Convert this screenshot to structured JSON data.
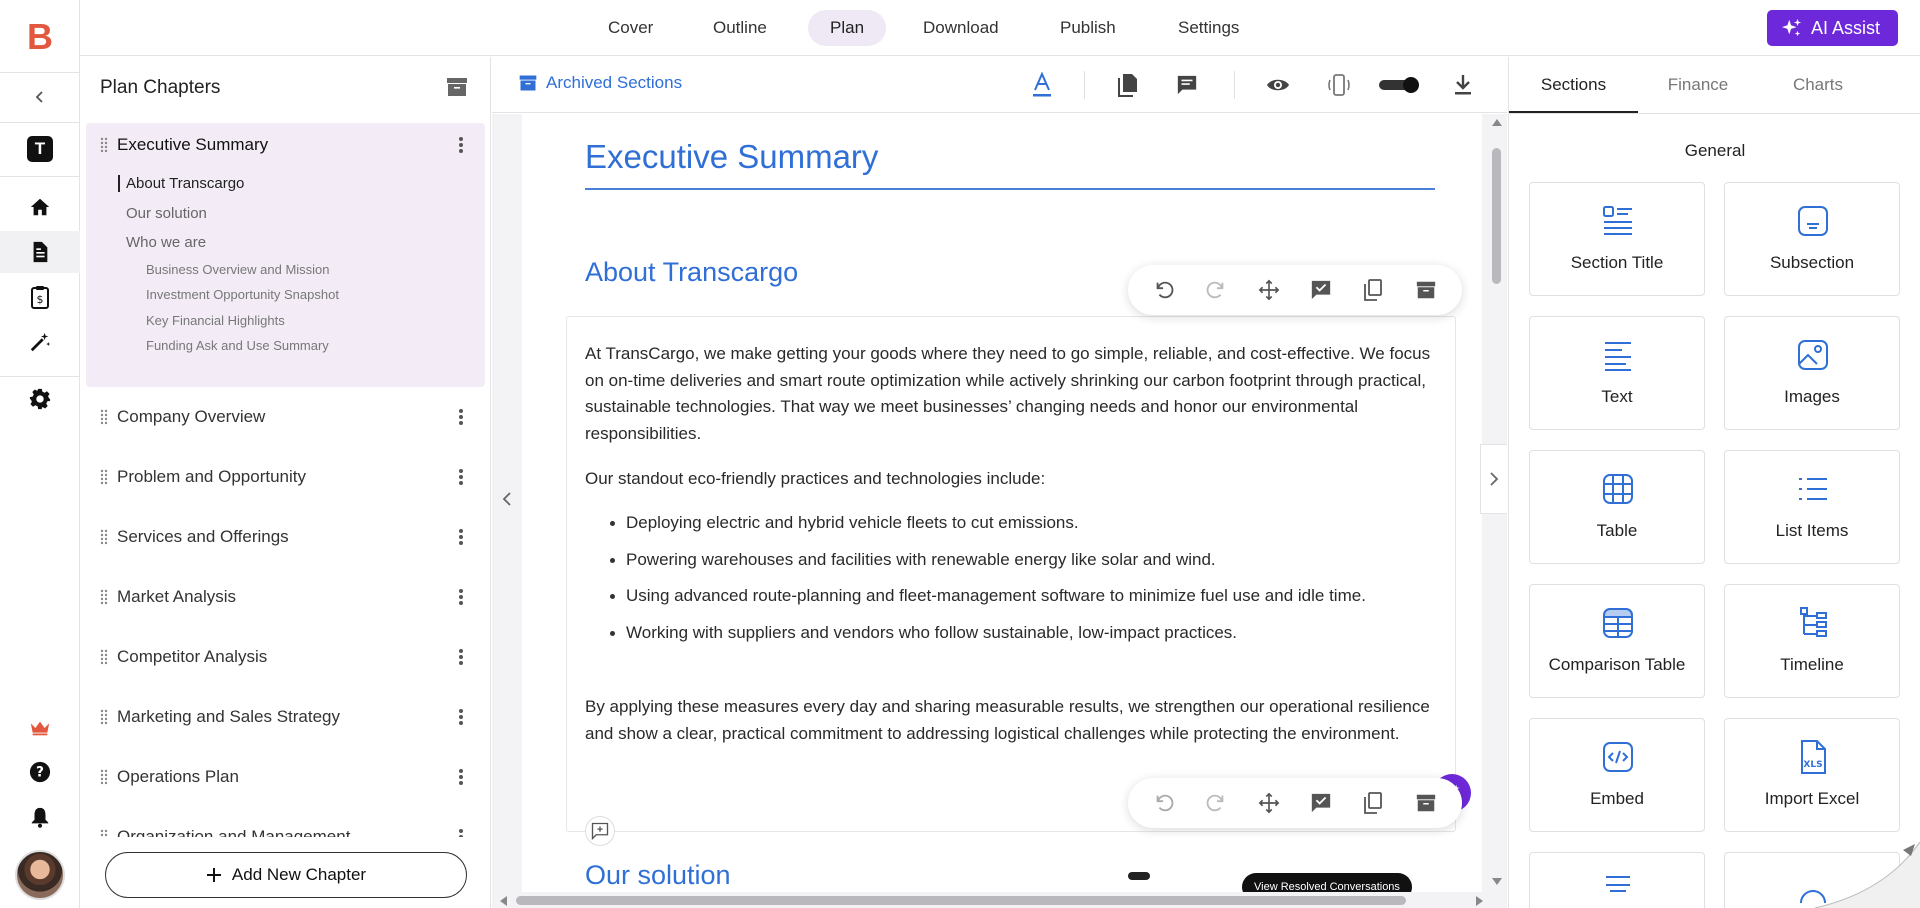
{
  "app": {
    "logo_letter": "B",
    "workspace_badge": "T"
  },
  "topnav": {
    "tabs": [
      {
        "label": "Cover"
      },
      {
        "label": "Outline"
      },
      {
        "label": "Plan"
      },
      {
        "label": "Download"
      },
      {
        "label": "Publish"
      },
      {
        "label": "Settings"
      }
    ],
    "active_tab": "Plan",
    "ai_assist_label": "AI Assist"
  },
  "colors": {
    "accent_blue": "#2f6fd6",
    "brand_purple": "#6d28d9",
    "logo_orange": "#e2583e",
    "active_chapter_bg": "#f3ecf6"
  },
  "chapters_panel": {
    "title": "Plan Chapters",
    "active_chapter": {
      "label": "Executive Summary",
      "subsections": [
        {
          "label": "About Transcargo"
        },
        {
          "label": "Our solution"
        },
        {
          "label": "Who we are"
        }
      ],
      "subsubsections": [
        {
          "label": "Business Overview and Mission"
        },
        {
          "label": "Investment Opportunity Snapshot"
        },
        {
          "label": "Key Financial Highlights"
        },
        {
          "label": "Funding Ask and Use Summary"
        }
      ]
    },
    "chapters": [
      {
        "label": "Company Overview"
      },
      {
        "label": "Problem and Opportunity"
      },
      {
        "label": "Services and Offerings"
      },
      {
        "label": "Market Analysis"
      },
      {
        "label": "Competitor Analysis"
      },
      {
        "label": "Marketing and Sales Strategy"
      },
      {
        "label": "Operations Plan"
      },
      {
        "label": "Organization and Management"
      }
    ],
    "add_chapter_label": "Add New Chapter"
  },
  "editor": {
    "archived_label": "Archived Sections",
    "doc_title": "Executive Summary",
    "section_heading": "About Transcargo",
    "paragraphs": [
      "At TransCargo, we make getting your goods where they need to go simple, reliable, and cost-effective. We focus on on-time deliveries and smart route optimization while actively shrinking our carbon footprint through practical, sustainable technologies. That way we meet businesses’ changing needs and honor our environmental responsibilities.",
      "Our standout eco-friendly practices and technologies include:",
      "By applying these measures every day and sharing measurable results, we strengthen our operational resilience and show a clear, practical commitment to addressing logistical challenges while protecting the environment."
    ],
    "bullets": [
      "Deploying electric and hybrid vehicle fleets to cut emissions.",
      "Powering warehouses and facilities with renewable energy like solar and wind.",
      "Using advanced route-planning and fleet-management software to minimize fuel use and idle time.",
      "Working with suppliers and vendors who follow sustainable, low-impact practices."
    ],
    "next_section_heading": "Our solution",
    "tooltip": "View Resolved Conversations",
    "toggle_on": true
  },
  "right_panel": {
    "tabs": [
      {
        "label": "Sections"
      },
      {
        "label": "Finance"
      },
      {
        "label": "Charts"
      }
    ],
    "active_tab": "Sections",
    "group_title": "General",
    "cards": [
      {
        "label": "Section Title",
        "icon": "section-title-icon"
      },
      {
        "label": "Subsection",
        "icon": "subsection-icon"
      },
      {
        "label": "Text",
        "icon": "text-icon"
      },
      {
        "label": "Images",
        "icon": "image-icon"
      },
      {
        "label": "Table",
        "icon": "table-icon"
      },
      {
        "label": "List Items",
        "icon": "list-icon"
      },
      {
        "label": "Comparison Table",
        "icon": "comparison-table-icon"
      },
      {
        "label": "Timeline",
        "icon": "timeline-icon"
      },
      {
        "label": "Embed",
        "icon": "embed-icon"
      },
      {
        "label": "Import Excel",
        "icon": "excel-icon"
      }
    ]
  }
}
